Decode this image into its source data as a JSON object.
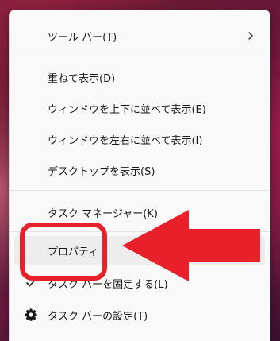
{
  "menu": {
    "items": [
      {
        "label": "ツール バー(T)",
        "icon": "chevron-right-icon"
      },
      {
        "label": "重ねて表示(D)"
      },
      {
        "label": "ウィンドウを上下に並べて表示(E)"
      },
      {
        "label": "ウィンドウを左右に並べて表示(I)"
      },
      {
        "label": "デスクトップを表示(S)"
      },
      {
        "label": "タスク マネージャー(K)"
      },
      {
        "label": "プロパティ"
      },
      {
        "label": "タスク バーを固定する(L)",
        "icon": "checkmark-icon"
      },
      {
        "label": "タスク バーの設定(T)",
        "icon": "gear-icon"
      }
    ]
  },
  "colors": {
    "annotation": "#e8202a",
    "menu_background": "#f9f9f9",
    "highlight": "#ededed"
  }
}
